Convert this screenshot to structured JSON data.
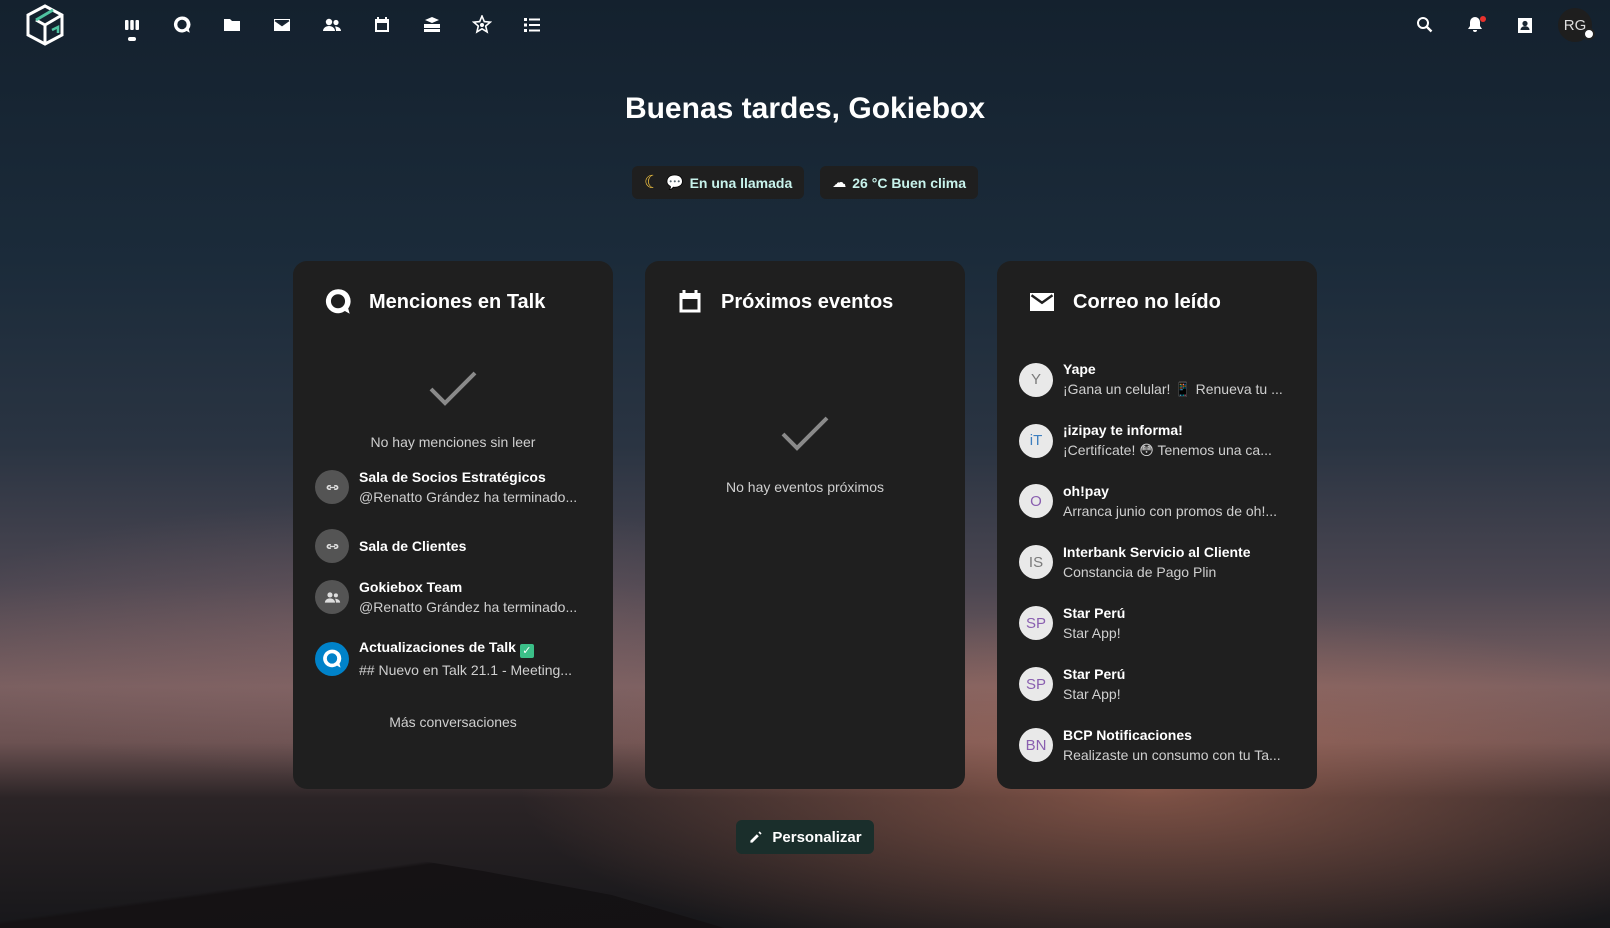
{
  "greeting": "Buenas tardes, Gokiebox",
  "status": {
    "call_label": "En una llamada",
    "weather_label": "26 °C Buen clima"
  },
  "header": {
    "apps": [
      "dashboard-icon",
      "talk-icon",
      "files-icon",
      "mail-icon",
      "contacts-icon",
      "calendar-icon",
      "deck-icon",
      "activity-icon",
      "tasks-icon"
    ],
    "avatar_initials": "RG"
  },
  "talk": {
    "title": "Menciones en Talk",
    "empty_text": "No hay menciones sin leer",
    "conversations": [
      {
        "name": "Sala de Socios Estratégicos",
        "message": "@Renatto Grández ha terminado...",
        "icon": "link-icon"
      },
      {
        "name": "Sala de Clientes",
        "message": "",
        "icon": "link-icon"
      },
      {
        "name": "Gokiebox Team",
        "message": "@Renatto Grández ha terminado...",
        "icon": "group-icon"
      },
      {
        "name": "Actualizaciones de Talk",
        "message": "## Nuevo en Talk 21.1 - Meeting...",
        "icon": "talk-icon"
      }
    ],
    "more_label": "Más conversaciones"
  },
  "events": {
    "title": "Próximos eventos",
    "empty_text": "No hay eventos próximos"
  },
  "mail": {
    "title": "Correo no leído",
    "messages": [
      {
        "initials": "Y",
        "sender": "Yape",
        "subject": "¡Gana un celular! 📱 Renueva tu ..."
      },
      {
        "initials": "iT",
        "sender": "¡izipay te informa!",
        "subject": "¡Certifícate! 😳 Tenemos una ca..."
      },
      {
        "initials": "O",
        "sender": "oh!pay",
        "subject": "Arranca junio con promos de oh!..."
      },
      {
        "initials": "IS",
        "sender": "Interbank Servicio al Cliente",
        "subject": "Constancia de Pago Plin"
      },
      {
        "initials": "SP",
        "sender": "Star Perú",
        "subject": "Star App!"
      },
      {
        "initials": "SP",
        "sender": "Star Perú",
        "subject": "Star App!"
      },
      {
        "initials": "BN",
        "sender": "BCP Notificaciones",
        "subject": "Realizaste un consumo con tu Ta..."
      }
    ]
  },
  "customize_label": "Personalizar",
  "colors": {
    "accent_text": "#c8f3ec",
    "panel_bg": "#1f1f1f",
    "talk_blue": "#0082c9"
  }
}
